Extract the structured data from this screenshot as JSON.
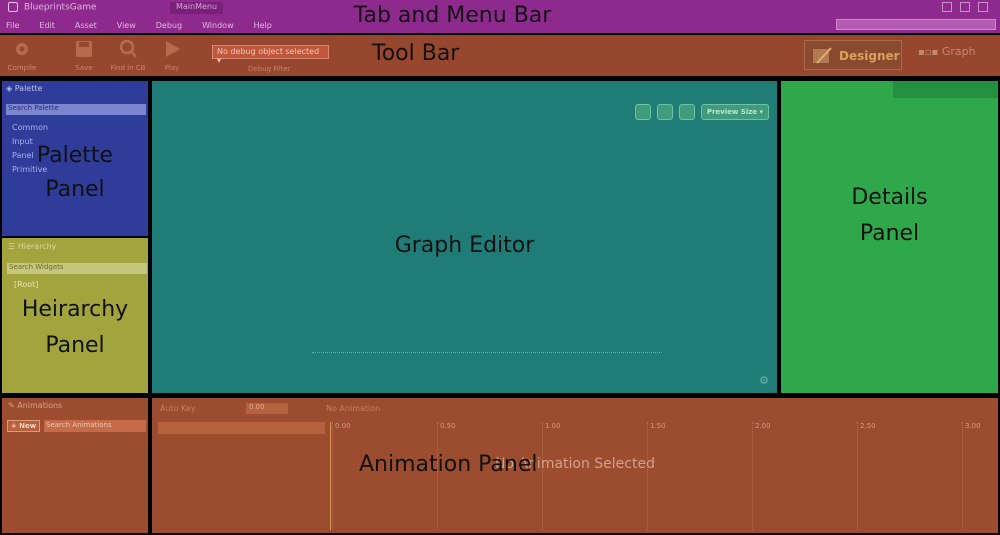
{
  "tabbar": {
    "app_tab": "BlueprintsGame",
    "asset_tab": "MainMenu",
    "menu": [
      "File",
      "Edit",
      "Asset",
      "View",
      "Debug",
      "Window",
      "Help"
    ],
    "region_title": "Tab and Menu Bar"
  },
  "toolbar": {
    "buttons": [
      {
        "label": "Compile",
        "icon": "gear-compile-icon"
      },
      {
        "label": "Save",
        "icon": "save-icon"
      },
      {
        "label": "Find in CB",
        "icon": "find-in-content-browser-icon"
      },
      {
        "label": "Play",
        "icon": "play-icon"
      }
    ],
    "debug_select": "No debug object selected",
    "debug_label": "Debug Filter",
    "designer_label": "Designer",
    "graph_label": "Graph",
    "region_title": "Tool Bar"
  },
  "palette": {
    "header": "Palette",
    "search_placeholder": "Search Palette",
    "items": [
      "Common",
      "Input",
      "Panel",
      "Primitive"
    ],
    "region_title_line1": "Palette",
    "region_title_line2": "Panel"
  },
  "hierarchy": {
    "header": "Hierarchy",
    "search_placeholder": "Search Widgets",
    "root": "[Root]",
    "region_title_line1": "Heirarchy",
    "region_title_line2": "Panel"
  },
  "graph": {
    "preview_size": "Preview Size",
    "region_title": "Graph Editor"
  },
  "details": {
    "region_title_line1": "Details",
    "region_title_line2": "Panel"
  },
  "animations": {
    "header": "Animations",
    "new_button": "+ New",
    "search_placeholder": "Search Animations"
  },
  "animpanel": {
    "auto_key": "Auto Key",
    "fps": "0.00",
    "no_animation": "No Animation",
    "ticks": [
      "0.00",
      "0.50",
      "1.00",
      "1.50",
      "2.00",
      "2.50",
      "3.00"
    ],
    "no_selection": "No Animation Selected",
    "region_title": "Animation Panel"
  },
  "colors": {
    "tabbar": "#8e2a8e",
    "toolbar": "#96472e",
    "palette": "#2f3c9a",
    "hierarchy": "#a2a43d",
    "graph": "#1f7c76",
    "details": "#2ea84a",
    "animation": "#9c4d2f"
  }
}
